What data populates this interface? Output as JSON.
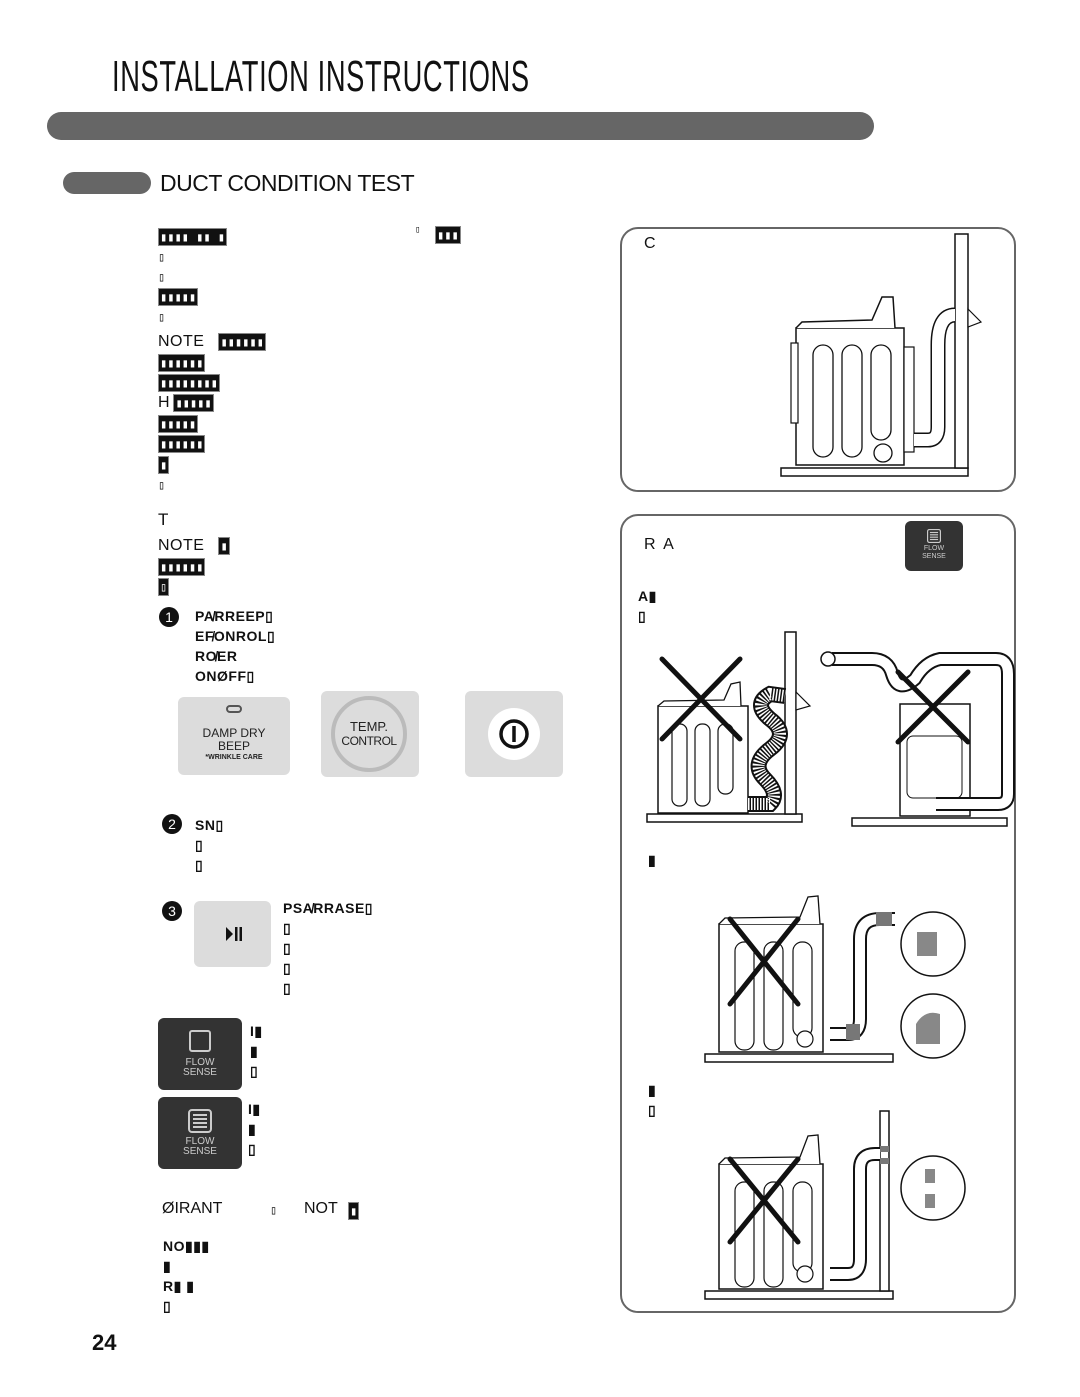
{
  "header": {
    "title": "INSTALLATION INSTRUCTIONS",
    "section_title": "DUCT CONDITION TEST"
  },
  "intro": {
    "lines": [
      "▮▮▮▮ ▮▮ ▮",
      "▯",
      "▯",
      "▮▮▮▮▮",
      "▯"
    ],
    "line0_trailing_a": "▯",
    "line0_trailing_b": "▮▮▮"
  },
  "note1": {
    "label": "NOTE",
    "first": "▮▮▮▮▮▮",
    "lines": [
      "▮▮▮▮▮▮",
      "▮▮▮▮▮▮▮▮",
      "▮▮▮▮▮",
      "▮▮▮▮▮",
      "▮▮▮▮▮▮",
      "▮",
      "▯"
    ],
    "h_prefix": "H"
  },
  "test": {
    "heading": "T",
    "note_label": "NOTE",
    "note_first": "▮",
    "note_lines": [
      "▮▮▮▮▮▮",
      "▯"
    ]
  },
  "steps": [
    {
      "number": "1",
      "lines": [
        "PA̸RREEP▯",
        "EF̸ONROL▯",
        "RO̸ER",
        "ONØFF▯"
      ]
    },
    {
      "number": "2",
      "lines": [
        "SN▯",
        "▯",
        "▯"
      ]
    },
    {
      "number": "3",
      "lines": [
        "PSA̸RRASE▯",
        "▯",
        "▯",
        "▯",
        "▯"
      ]
    }
  ],
  "control_panel": {
    "damp_dry": {
      "line1": "DAMP DRY",
      "line2": "BEEP",
      "line3": "*WRINKLE CARE"
    },
    "temp_control": {
      "line1": "TEMP.",
      "line2": "CONTROL"
    },
    "power_icon": "power-icon",
    "start_pause_icon": "play-pause-icon"
  },
  "flow_sense": {
    "label1": "FLOW",
    "label2": "SENSE",
    "empty": {
      "lines": [
        "I▮",
        "▮",
        "▯"
      ]
    },
    "full": {
      "lines": [
        "I▮",
        "▮",
        "▯"
      ]
    }
  },
  "important": {
    "label": "ØIRANT",
    "mid": "▯",
    "not_label": "NOT",
    "not_tail": "▮"
  },
  "final_note": {
    "lines": [
      "NO▮▮▮",
      "▮",
      "R▮ ▮",
      "▯"
    ]
  },
  "right_panel": {
    "box1": {
      "label": "C"
    },
    "box2": {
      "label": "R A",
      "line1": "A▮",
      "line2": "▯",
      "line3": "▮",
      "line4": "▮",
      "line5": "▯"
    }
  },
  "footer": {
    "page_number": "24"
  }
}
